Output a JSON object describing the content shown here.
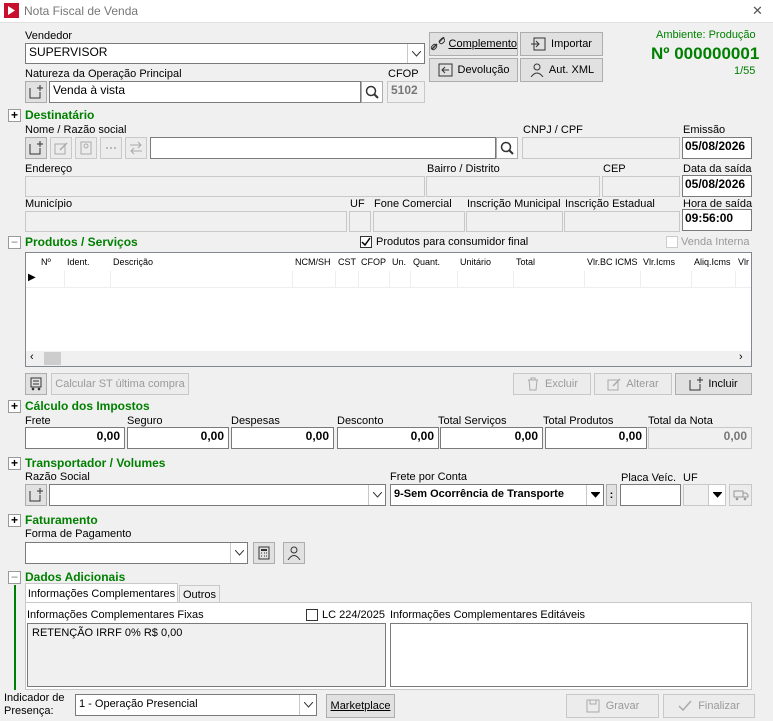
{
  "window": {
    "title": "Nota Fiscal de Venda",
    "close": "✕"
  },
  "header": {
    "ambiente": "Ambiente: Produção",
    "numero": "Nº 000000001",
    "pagina": "1/55",
    "btn_complemento": "Complemento",
    "btn_importar": "Importar",
    "btn_devolucao": "Devolução",
    "btn_aut_xml": "Aut. XML"
  },
  "vendedor": {
    "label": "Vendedor",
    "value": "SUPERVISOR"
  },
  "natureza": {
    "label": "Natureza da Operação Principal",
    "value": "Venda à vista"
  },
  "cfop": {
    "label": "CFOP",
    "value": "5102"
  },
  "destinatario": {
    "title": "Destinatário",
    "nome_label": "Nome / Razão social",
    "cnpj_label": "CNPJ / CPF",
    "emissao_label": "Emissão",
    "emissao": "05/08/2026",
    "endereco_label": "Endereço",
    "bairro_label": "Bairro / Distrito",
    "cep_label": "CEP",
    "saida_label": "Data da saída",
    "saida": "05/08/2026",
    "municipio_label": "Município",
    "uf_label": "UF",
    "fone_label": "Fone Comercial",
    "im_label": "Inscrição Municipal",
    "ie_label": "Inscrição Estadual",
    "hora_label": "Hora de saída",
    "hora": "09:56:00"
  },
  "produtos": {
    "title": "Produtos / Serviços",
    "consumidor_final": "Produtos para consumidor final",
    "venda_interna": "Venda Interna",
    "columns": [
      "Nº",
      "Ident.",
      "Descrição",
      "NCM/SH",
      "CST",
      "CFOP",
      "Un.",
      "Quant.",
      "Unitário",
      "Total",
      "Vlr.BC ICMS",
      "Vlr.Icms",
      "Aliq.Icms",
      "Vlr"
    ],
    "row_marker": "▶",
    "btn_calcular": "Calcular ST última compra",
    "btn_excluir": "Excluir",
    "btn_alterar": "Alterar",
    "btn_incluir": "Incluir"
  },
  "impostos": {
    "title": "Cálculo dos Impostos",
    "fields": [
      {
        "label": "Frete",
        "value": "0,00"
      },
      {
        "label": "Seguro",
        "value": "0,00"
      },
      {
        "label": "Despesas",
        "value": "0,00"
      },
      {
        "label": "Desconto",
        "value": "0,00"
      },
      {
        "label": "Total Serviços",
        "value": "0,00"
      },
      {
        "label": "Total Produtos",
        "value": "0,00"
      },
      {
        "label": "Total da Nota",
        "value": "0,00"
      }
    ]
  },
  "transportador": {
    "title": "Transportador / Volumes",
    "razao_label": "Razão Social",
    "frete_label": "Frete por Conta",
    "frete_value": "9-Sem Ocorrência de Transporte",
    "placa_label": "Placa Veíc.",
    "uf_label": "UF"
  },
  "faturamento": {
    "title": "Faturamento",
    "forma_label": "Forma de Pagamento"
  },
  "adicionais": {
    "title": "Dados Adicionais",
    "tab1": "Informações Complementares",
    "tab2": "Outros",
    "fixas_label": "Informações Complementares Fixas",
    "lc_label": "LC 224/2025",
    "editaveis_label": "Informações Complementares Editáveis",
    "fixas_text": "RETENÇÃO IRRF 0% R$ 0,00"
  },
  "footer": {
    "indicador_label1": "Indicador de",
    "indicador_label2": "Presença:",
    "indicador_value": "1 - Operação Presencial",
    "btn_marketplace": "Marketplace",
    "btn_gravar": "Gravar",
    "btn_finalizar": "Finalizar"
  },
  "colors": {
    "green": "#008000",
    "brand_red": "#c8102e"
  }
}
